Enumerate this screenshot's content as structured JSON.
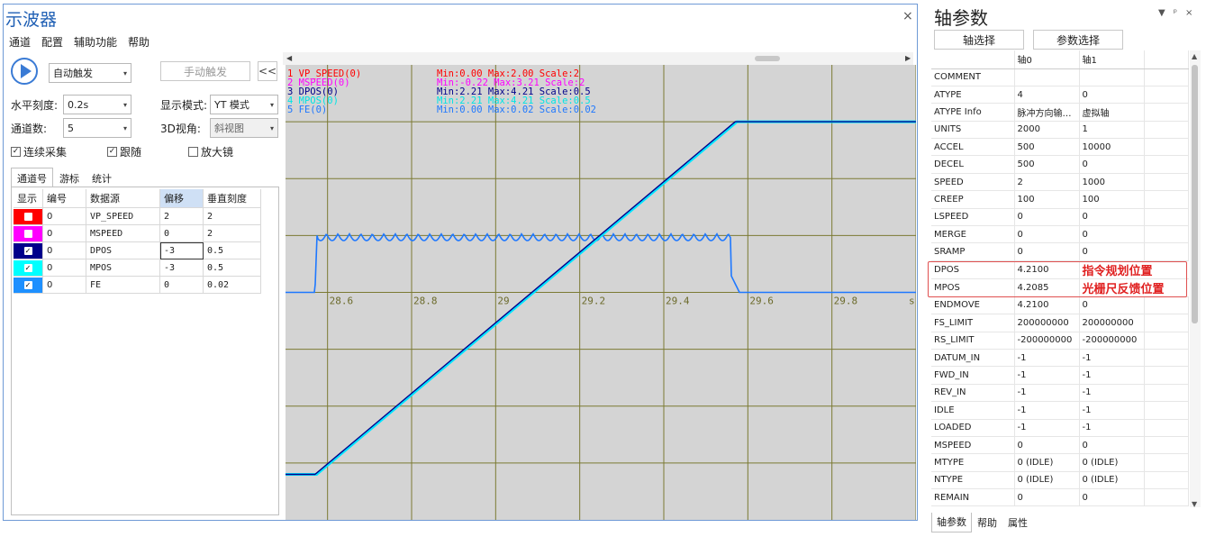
{
  "osc": {
    "title": "示波器",
    "close": "×",
    "menu": [
      "通道",
      "配置",
      "辅助功能",
      "帮助"
    ],
    "trigger_mode": "自动触发",
    "manual_trigger": "手动触发",
    "collapse": "<<",
    "h_scale_label": "水平刻度:",
    "h_scale_value": "0.2s",
    "display_mode_label": "显示模式:",
    "display_mode_value": "YT 模式",
    "channels_label": "通道数:",
    "channels_value": "5",
    "view3d_label": "3D视角:",
    "view3d_value": "斜视图",
    "continuous": "连续采集",
    "follow": "跟随",
    "magnifier": "放大镜",
    "tabs": [
      "通道号",
      "游标",
      "统计"
    ],
    "table_headers": [
      "显示",
      "编号",
      "数据源",
      "偏移",
      "垂直刻度"
    ],
    "rows": [
      {
        "color": "#ff0000",
        "checked": "",
        "no": "0",
        "source": "VP_SPEED",
        "offset": "2",
        "scale": "2"
      },
      {
        "color": "#ff00ff",
        "checked": "",
        "no": "0",
        "source": "MSPEED",
        "offset": "0",
        "scale": "2"
      },
      {
        "color": "#00008b",
        "checked": "✓",
        "no": "0",
        "source": "DPOS",
        "offset": "-3",
        "scale": "0.5"
      },
      {
        "color": "#00ffff",
        "checked": "✓",
        "no": "0",
        "source": "MPOS",
        "offset": "-3",
        "scale": "0.5"
      },
      {
        "color": "#1e90ff",
        "checked": "✓",
        "no": "0",
        "source": "FE",
        "offset": "0",
        "scale": "0.02"
      }
    ]
  },
  "plot": {
    "legend": [
      {
        "name": "1 VP_SPEED(0)",
        "stats": "Min:0.00  Max:2.00  Scale:2",
        "color": "#ff0000"
      },
      {
        "name": "2 MSPEED(0)",
        "stats": "Min:-0.22  Max:3.21  Scale:2",
        "color": "#ff00ff"
      },
      {
        "name": "3 DPOS(0)",
        "stats": "Min:2.21  Max:4.21  Scale:0.5",
        "color": "#00008b"
      },
      {
        "name": "4 MPOS(0)",
        "stats": "Min:2.21  Max:4.21  Scale:0.5",
        "color": "#00e5e5"
      },
      {
        "name": "5 FE(0)",
        "stats": "Min:0.00  Max:0.02  Scale:0.02",
        "color": "#1e78ff"
      }
    ],
    "x_ticks": [
      "28.6",
      "28.8",
      "29",
      "29.2",
      "29.4",
      "29.6",
      "29.8"
    ],
    "x_unit": "s",
    "x_range": [
      28.5,
      30.0
    ],
    "pos_ramp": {
      "t0": 28.57,
      "t1": 29.57,
      "start_y": -3.2,
      "end_y": 3.0
    },
    "fe": {
      "rise": 28.57,
      "fall": 29.56,
      "level": 1.0,
      "base": 0.0
    },
    "y_range": [
      -4,
      4
    ]
  },
  "axes": {
    "title": "轴参数",
    "ctrl_icons": [
      "▼",
      "ᵖ",
      "×"
    ],
    "axis_select": "轴选择",
    "param_select": "参数选择",
    "col_headers": [
      "",
      "轴0",
      "轴1"
    ],
    "rows": [
      [
        "COMMENT",
        "",
        ""
      ],
      [
        "ATYPE",
        "4",
        "0"
      ],
      [
        "ATYPE Info",
        "脉冲方向输…",
        "虚拟轴"
      ],
      [
        "UNITS",
        "2000",
        "1"
      ],
      [
        "ACCEL",
        "500",
        "10000"
      ],
      [
        "DECEL",
        "500",
        "0"
      ],
      [
        "SPEED",
        "2",
        "1000"
      ],
      [
        "CREEP",
        "100",
        "100"
      ],
      [
        "LSPEED",
        "0",
        "0"
      ],
      [
        "MERGE",
        "0",
        "0"
      ],
      [
        "SRAMP",
        "0",
        "0"
      ],
      [
        "DPOS",
        "4.2100",
        "指令规划位置"
      ],
      [
        "MPOS",
        "4.2085",
        "光栅尺反馈位置"
      ],
      [
        "ENDMOVE",
        "4.2100",
        "0"
      ],
      [
        "FS_LIMIT",
        "200000000",
        "200000000"
      ],
      [
        "RS_LIMIT",
        "-200000000",
        "-200000000"
      ],
      [
        "DATUM_IN",
        "-1",
        "-1"
      ],
      [
        "FWD_IN",
        "-1",
        "-1"
      ],
      [
        "REV_IN",
        "-1",
        "-1"
      ],
      [
        "IDLE",
        "-1",
        "-1"
      ],
      [
        "LOADED",
        "-1",
        "-1"
      ],
      [
        "MSPEED",
        "0",
        "0"
      ],
      [
        "MTYPE",
        "0 (IDLE)",
        "0 (IDLE)"
      ],
      [
        "NTYPE",
        "0 (IDLE)",
        "0 (IDLE)"
      ],
      [
        "REMAIN",
        "0",
        "0"
      ]
    ],
    "bottom_tabs": [
      "轴参数",
      "帮助",
      "属性"
    ]
  }
}
